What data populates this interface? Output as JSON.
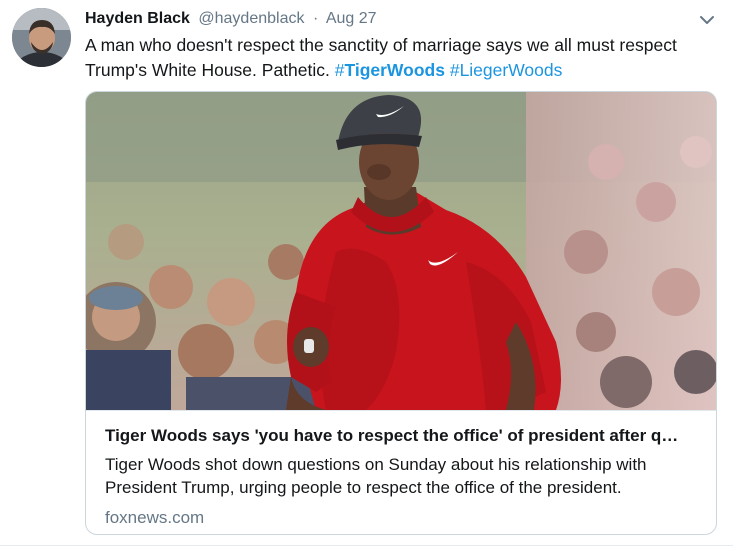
{
  "tweet": {
    "author_name": "Hayden Black",
    "handle": "@haydenblack",
    "separator": "·",
    "timestamp": "Aug 27",
    "text_plain": "A man who doesn't respect the sanctity of marriage says we all must respect Trump's White House. Pathetic. ",
    "hashtags": [
      {
        "prefix": "#",
        "word": "TigerWoods"
      },
      {
        "prefix": "#",
        "word": "LiegerWoods"
      }
    ],
    "menu_icon": "chevron-down-icon"
  },
  "card": {
    "title": "Tiger Woods says 'you have to respect the office' of president after q…",
    "description": "Tiger Woods shot down questions on Sunday about his relationship with President Trump, urging people to respect the office of the president.",
    "domain": "foxnews.com"
  },
  "colors": {
    "link": "#1b95e0",
    "secondary_text": "#657786",
    "border": "#ccd6dd",
    "shirt_red": "#c8141c"
  }
}
